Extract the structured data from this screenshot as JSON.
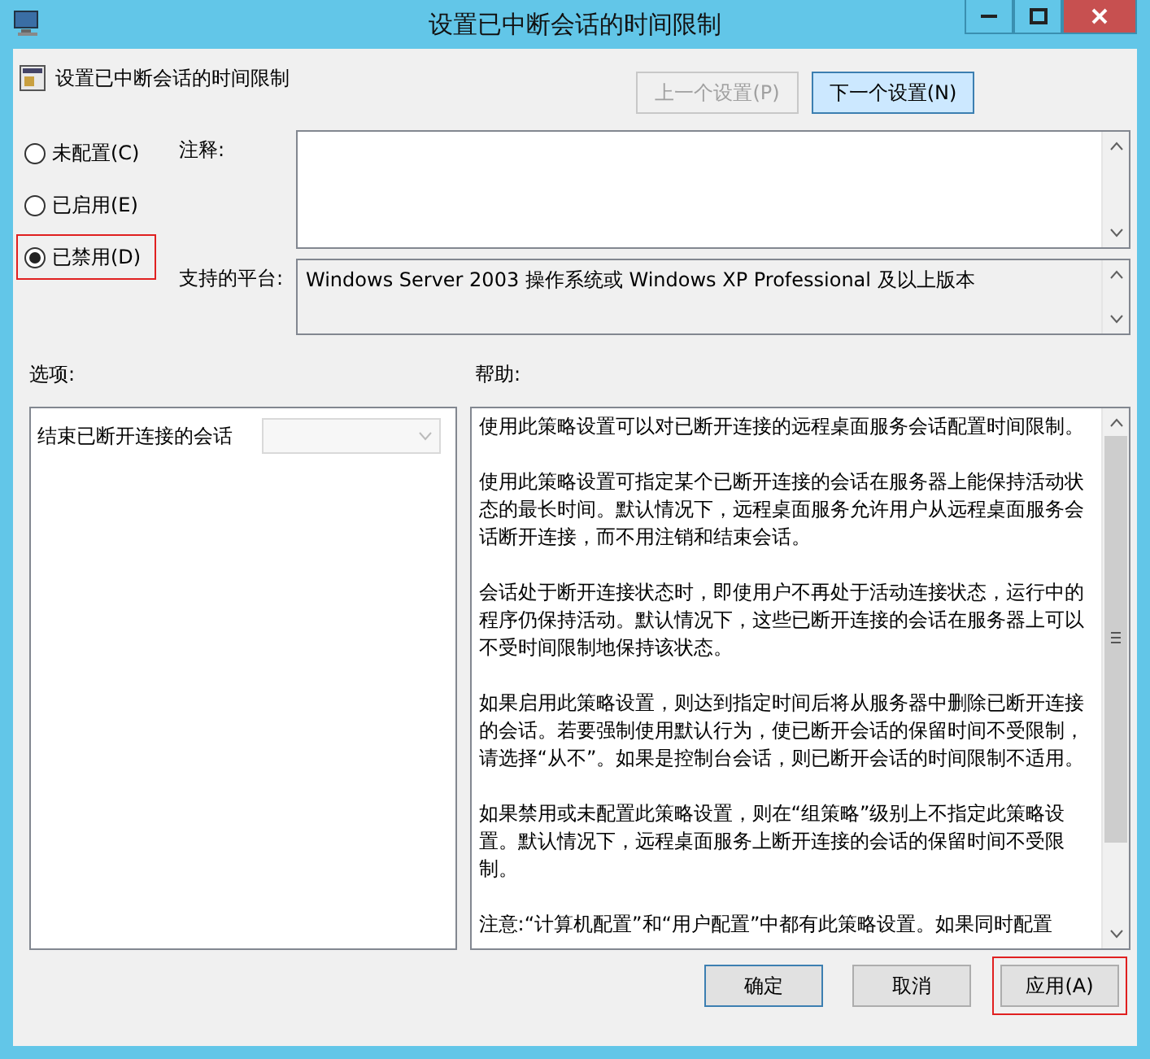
{
  "window": {
    "title": "设置已中断会话的时间限制"
  },
  "header": {
    "title": "设置已中断会话的时间限制"
  },
  "nav_buttons": [
    {
      "label": "上一个设置(P)",
      "disabled": true,
      "selected": false
    },
    {
      "label": "下一个设置(N)",
      "disabled": false,
      "selected": true
    }
  ],
  "states": [
    {
      "label": "未配置(C)",
      "selected": false,
      "highlighted": false
    },
    {
      "label": "已启用(E)",
      "selected": false,
      "highlighted": false
    },
    {
      "label": "已禁用(D)",
      "selected": true,
      "highlighted": true
    }
  ],
  "comment": {
    "label": "注释:"
  },
  "platform": {
    "label": "支持的平台:",
    "value": "Windows Server 2003 操作系统或 Windows XP Professional 及以上版本"
  },
  "options": {
    "label": "选项:",
    "items": [
      {
        "label": "结束已断开连接的会话",
        "disabled": true
      }
    ]
  },
  "help": {
    "label": "帮助:",
    "paragraphs": [
      "使用此策略设置可以对已断开连接的远程桌面服务会话配置时间限制。",
      "使用此策略设置可指定某个已断开连接的会话在服务器上能保持活动状态的最长时间。默认情况下，远程桌面服务允许用户从远程桌面服务会话断开连接，而不用注销和结束会话。",
      "会话处于断开连接状态时，即使用户不再处于活动连接状态，运行中的程序仍保持活动。默认情况下，这些已断开连接的会话在服务器上可以不受时间限制地保持该状态。",
      "如果启用此策略设置，则达到指定时间后将从服务器中删除已断开连接的会话。若要强制使用默认行为，使已断开会话的保留时间不受限制，请选择“从不”。如果是控制台会话，则已断开会话的时间限制不适用。",
      "如果禁用或未配置此策略设置，则在“组策略”级别上不指定此策略设置。默认情况下，远程桌面服务上断开连接的会话的保留时间不受限制。",
      "注意:“计算机配置”和“用户配置”中都有此策略设置。如果同时配置"
    ]
  },
  "buttons": [
    {
      "label": "确定",
      "default": true,
      "highlighted": false
    },
    {
      "label": "取消",
      "default": false,
      "highlighted": false
    },
    {
      "label": "应用(A)",
      "default": false,
      "highlighted": true
    }
  ]
}
